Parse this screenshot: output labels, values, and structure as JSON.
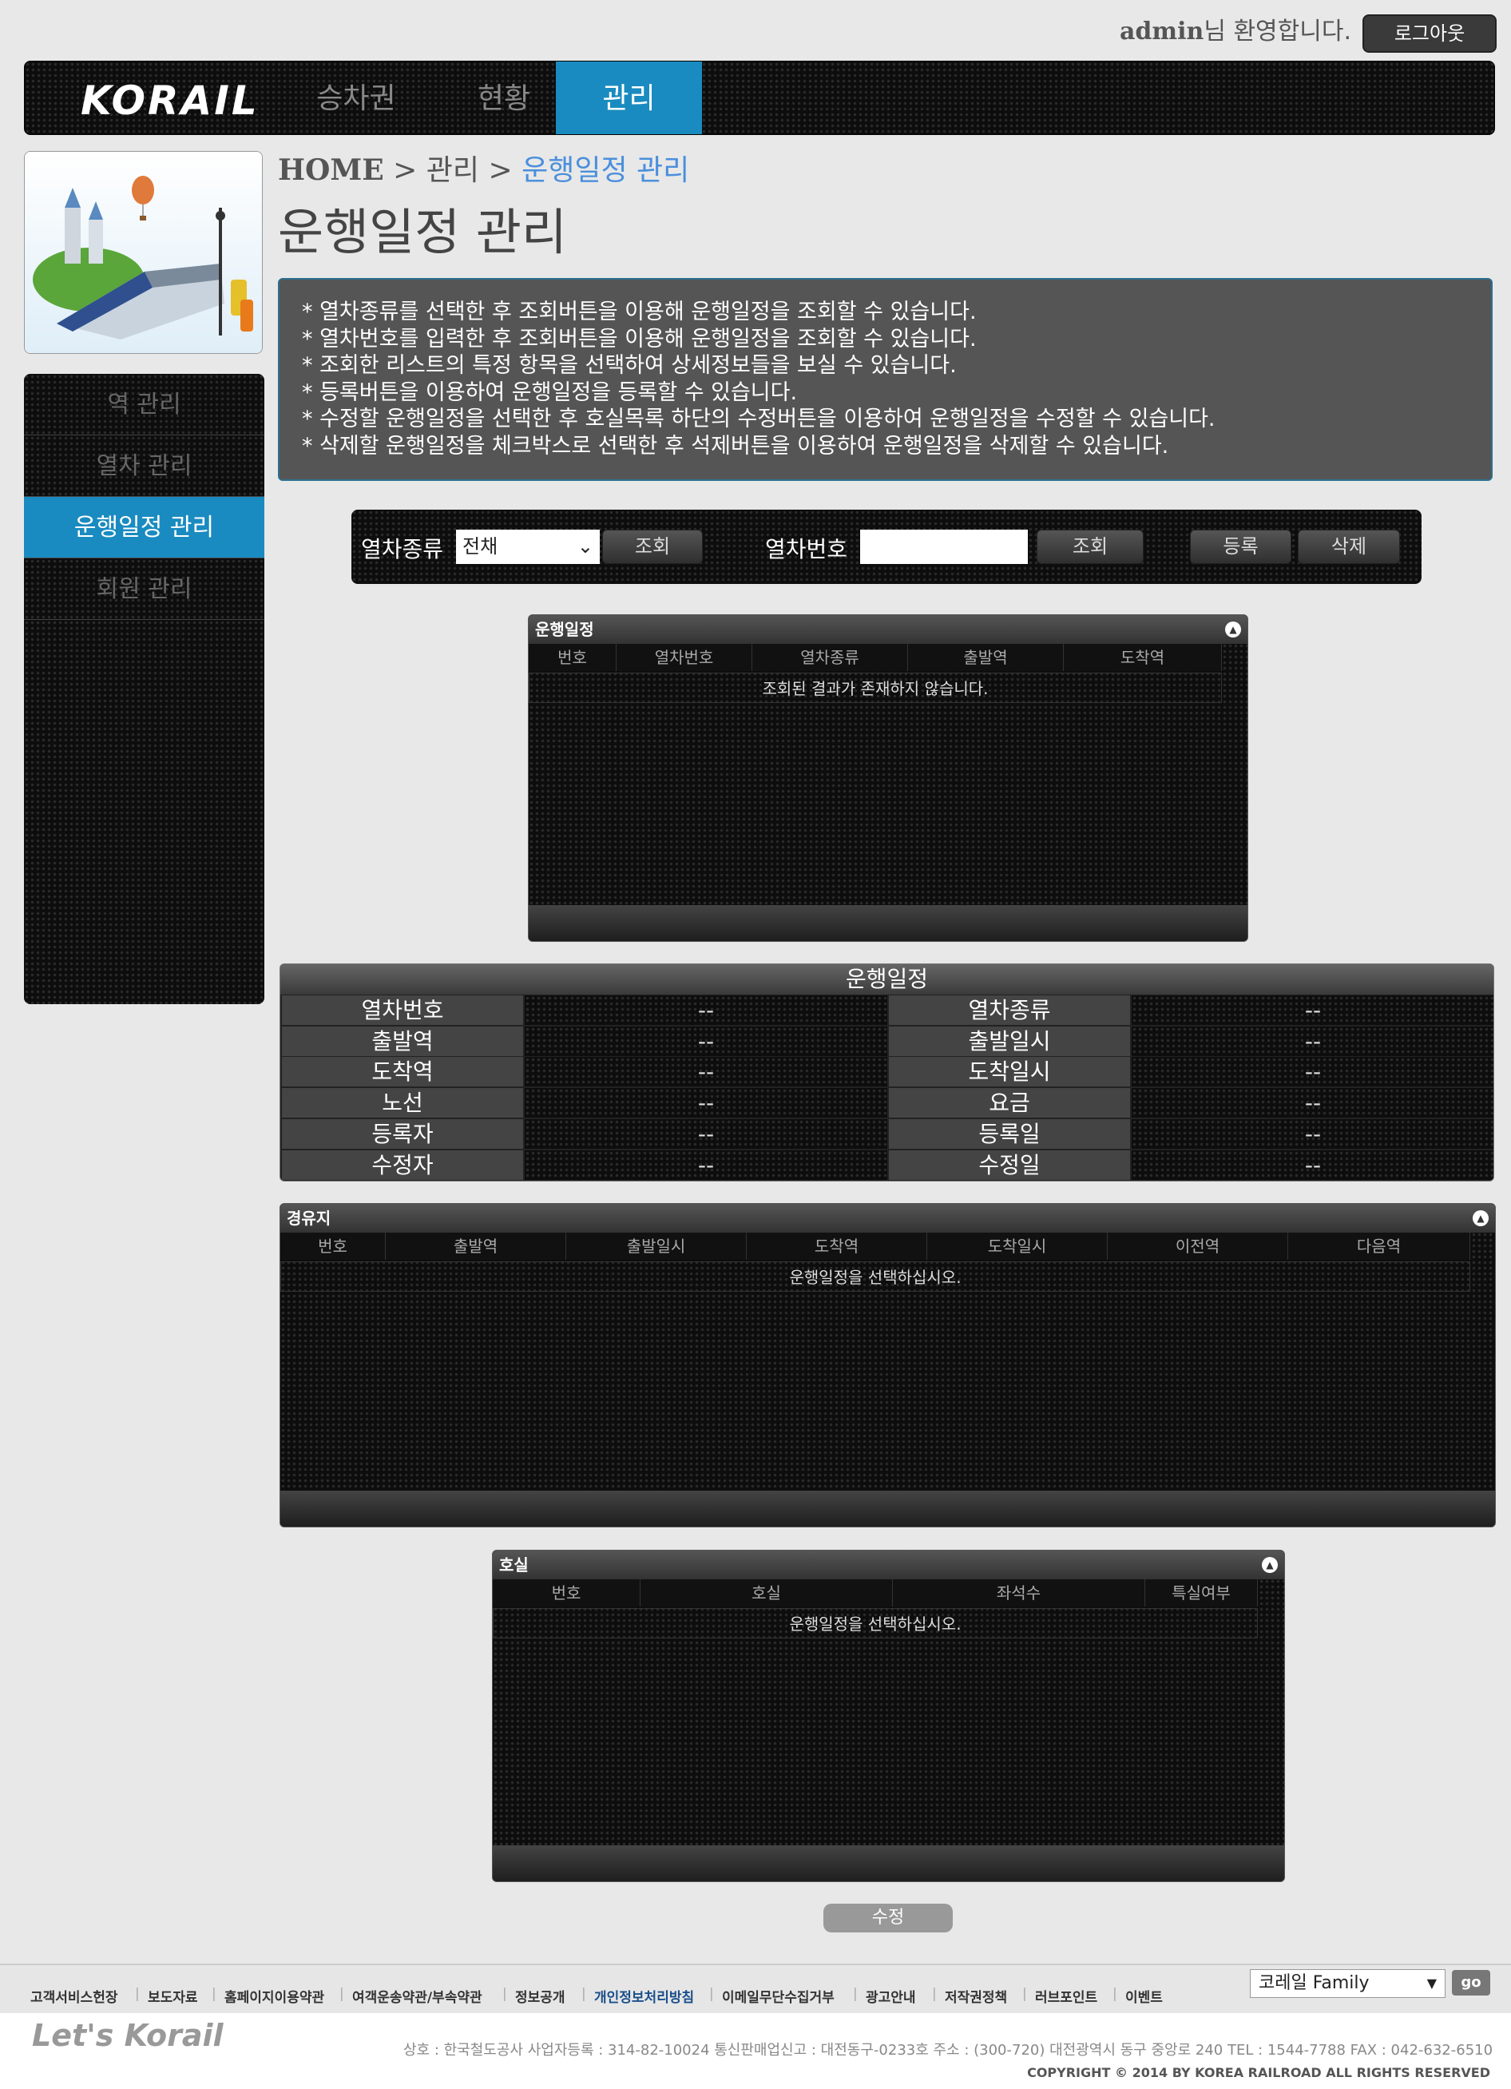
{
  "header": {
    "user": "admin",
    "welcome_suffix": "님 환영합니다.",
    "logout": "로그아웃"
  },
  "nav": {
    "logo": "KORAIL",
    "tabs": [
      "승차권",
      "현황",
      "관리"
    ],
    "active_tab": "관리"
  },
  "sidebar": {
    "items": [
      "역 관리",
      "열차 관리",
      "운행일정 관리",
      "회원 관리"
    ],
    "active": "운행일정 관리"
  },
  "breadcrumb": {
    "home": "HOME",
    "sep": ">",
    "section": "관리",
    "current": "운행일정 관리"
  },
  "page_title": "운행일정 관리",
  "info_lines": [
    "* 열차종류를 선택한 후 조회버튼을 이용해 운행일정을 조회할 수 있습니다.",
    "* 열차번호를 입력한 후 조회버튼을 이용해 운행일정을 조회할 수 있습니다.",
    "* 조회한 리스트의 특정 항목을 선택하여 상세정보들을 보실 수 있습니다.",
    "* 등록버튼을 이용하여 운행일정을 등록할 수 있습니다.",
    "* 수정할 운행일정을 선택한 후 호실목록 하단의 수정버튼을 이용하여 운행일정을 수정할 수 있습니다.",
    "* 삭제할 운행일정을 체크박스로 선택한 후 석제버튼을 이용하여 운행일정을 삭제할 수 있습니다."
  ],
  "search": {
    "type_label": "열차종류",
    "type_value": "전채",
    "search_btn": "조회",
    "num_label": "열차번호",
    "num_value": "",
    "register_btn": "등록",
    "delete_btn": "삭제"
  },
  "schedule_grid": {
    "title": "운행일정",
    "columns": [
      "번호",
      "열차번호",
      "열차종류",
      "출발역",
      "도착역"
    ],
    "empty": "조회된 결과가 존재하지 않습니다."
  },
  "detail": {
    "title": "운행일정",
    "rows": [
      {
        "l1": "열차번호",
        "v1": "--",
        "l2": "열차종류",
        "v2": "--"
      },
      {
        "l1": "출발역",
        "v1": "--",
        "l2": "출발일시",
        "v2": "--"
      },
      {
        "l1": "도착역",
        "v1": "--",
        "l2": "도착일시",
        "v2": "--"
      },
      {
        "l1": "노선",
        "v1": "--",
        "l2": "요금",
        "v2": "--"
      },
      {
        "l1": "등록자",
        "v1": "--",
        "l2": "등록일",
        "v2": "--"
      },
      {
        "l1": "수정자",
        "v1": "--",
        "l2": "수정일",
        "v2": "--"
      }
    ]
  },
  "waypoint_grid": {
    "title": "경유지",
    "columns": [
      "번호",
      "출발역",
      "출발일시",
      "도착역",
      "도착일시",
      "이전역",
      "다음역"
    ],
    "empty": "운행일정을 선택하십시오."
  },
  "room_grid": {
    "title": "호실",
    "columns": [
      "번호",
      "호실",
      "좌석수",
      "특실여부"
    ],
    "empty": "운행일정을 선택하십시오."
  },
  "edit_btn": "수정",
  "footer": {
    "links": [
      "고객서비스헌장",
      "보도자료",
      "홈페이지이용약관",
      "여객운송약관/부속약관",
      "정보공개",
      "개인정보처리방침",
      "이메일무단수집거부",
      "광고안내",
      "저작권정책",
      "러브포인트",
      "이벤트"
    ],
    "family": "코레일 Family",
    "go": "go",
    "brand": "Let's Korail",
    "info": "상호 : 한국철도공사    사업자등록 : 314-82-10024    통신판매업신고 : 대전동구-0233호    주소 : (300-720) 대전광역시 동구 중앙로 240    TEL : 1544-7788    FAX : 042-632-6510",
    "copyright": "COPYRIGHT © 2014 BY KOREA RAILROAD  ALL RIGHTS RESERVED"
  },
  "colors": {
    "accent": "#1a8bc0",
    "breadcrumb_current": "#4a8fdc",
    "info_bg": "#555555"
  }
}
